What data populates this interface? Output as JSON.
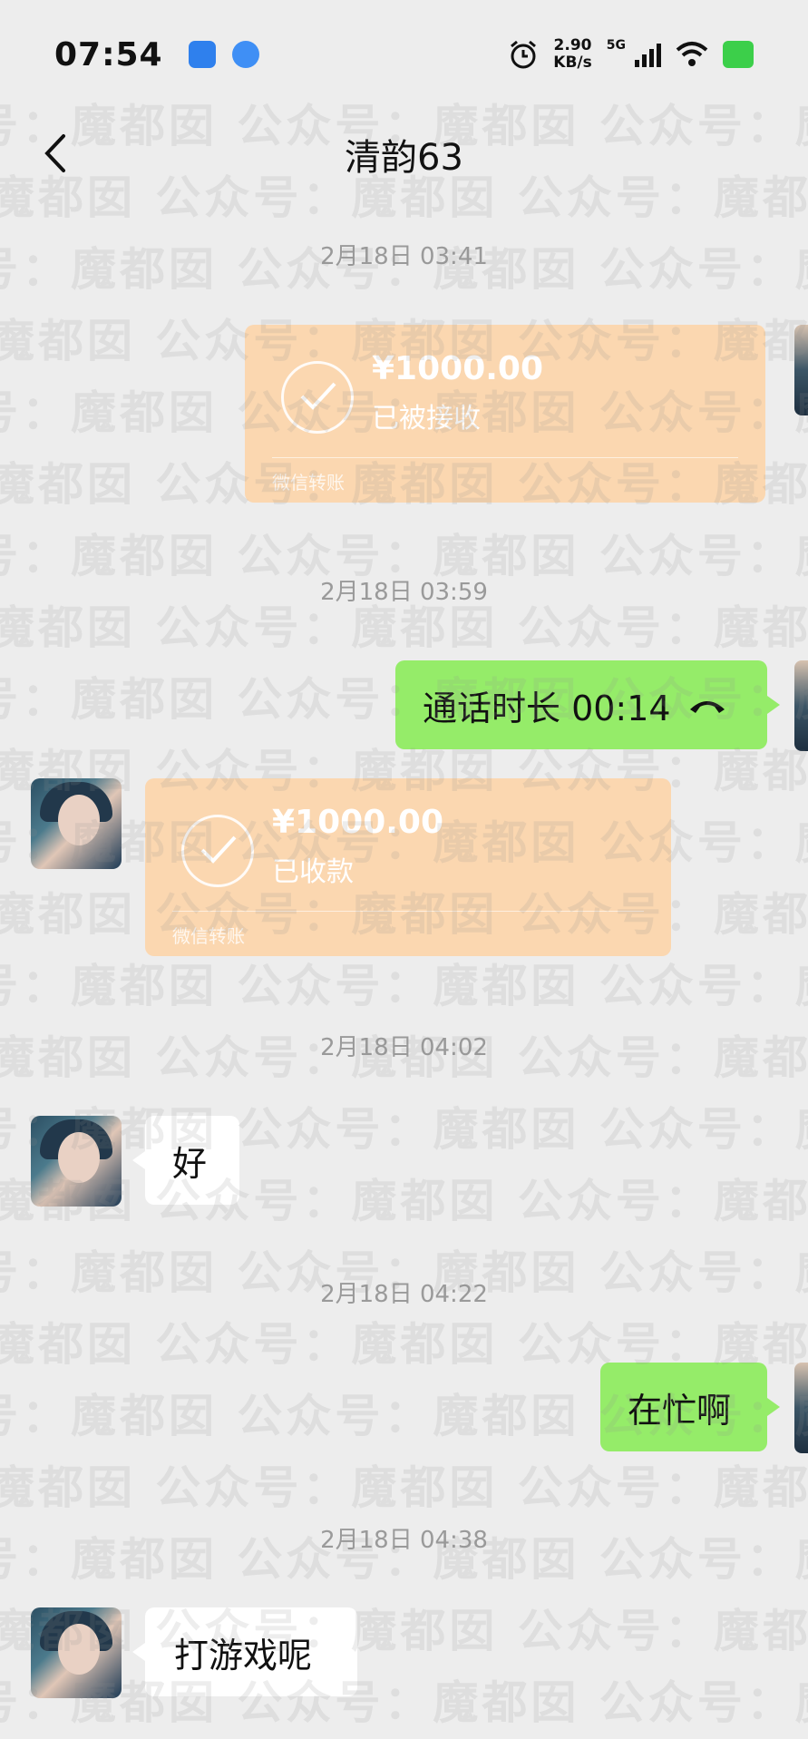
{
  "status_bar": {
    "time": "07:54",
    "net_speed_value": "2.90",
    "net_speed_unit": "KB/s",
    "network_type": "5G"
  },
  "nav": {
    "title": "清韵63"
  },
  "watermark": {
    "text": "号：魔都囡 公众号：魔都囡 公众号：魔都囡 公众号：魔都囡"
  },
  "messages": {
    "ts1": "2月18日 03:41",
    "transfer1": {
      "amount": "¥1000.00",
      "status": "已被接收",
      "footer": "微信转账"
    },
    "ts2": "2月18日 03:59",
    "call": {
      "text": "通话时长 00:14"
    },
    "transfer2": {
      "amount": "¥1000.00",
      "status": "已收款",
      "footer": "微信转账"
    },
    "ts3": "2月18日 04:02",
    "msg1": "好",
    "ts4": "2月18日 04:22",
    "msg2": "在忙啊",
    "ts5": "2月18日 04:38",
    "msg3": "打游戏呢"
  },
  "colors": {
    "background": "#ededed",
    "sent_bubble": "#95ec69",
    "received_bubble": "#ffffff",
    "transfer_card": "#fbd7b0"
  }
}
